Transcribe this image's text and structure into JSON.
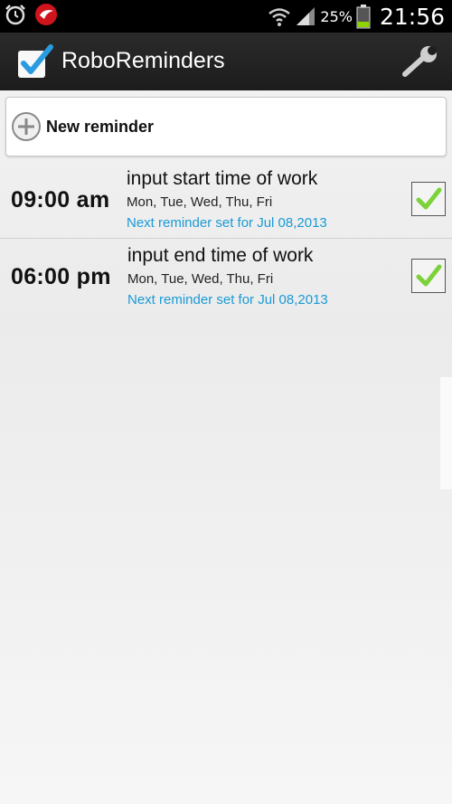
{
  "status_bar": {
    "icons": [
      "alarm-clock-icon",
      "trend-micro-icon",
      "wifi-icon",
      "signal-icon",
      "battery-icon"
    ],
    "battery_percent": "25%",
    "time": "21:56"
  },
  "action_bar": {
    "title": "RoboReminders",
    "icon": "checkbox-icon",
    "settings_icon": "wrench-icon"
  },
  "new_reminder": {
    "label": "New reminder",
    "icon": "plus-circle-icon"
  },
  "reminders": [
    {
      "time": "09:00 am",
      "title": "input start time of work",
      "days": "Mon, Tue, Wed, Thu, Fri",
      "next": "Next reminder set for Jul 08,2013",
      "enabled": true
    },
    {
      "time": "06:00 pm",
      "title": "input end time of work",
      "days": "Mon, Tue, Wed, Thu, Fri",
      "next": "Next reminder set for Jul 08,2013",
      "enabled": true
    }
  ],
  "colors": {
    "accent_blue": "#1a9ad6",
    "check_green": "#7cd23a",
    "action_bar": "#222222"
  }
}
